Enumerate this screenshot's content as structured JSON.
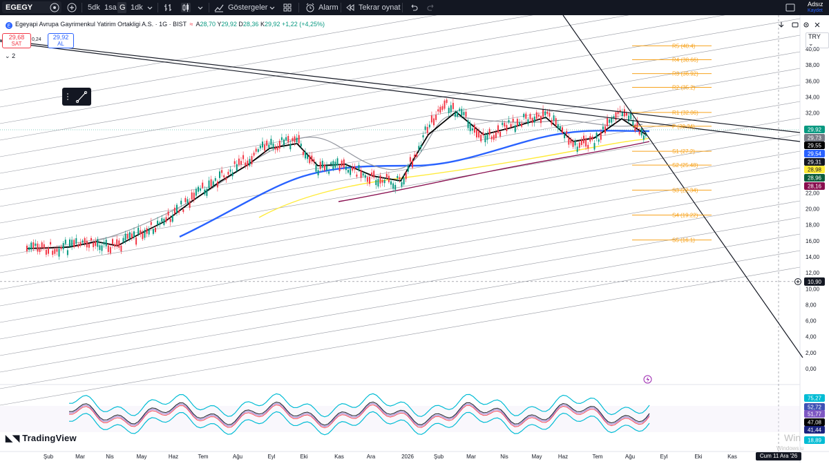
{
  "topbar": {
    "symbol": "EGEGY",
    "intervals": [
      "5dk",
      "1sa",
      "G",
      "1dk"
    ],
    "indicators_label": "Göstergeler",
    "alarm_label": "Alarm",
    "replay_label": "Tekrar oynat",
    "user_name": "Adsız",
    "save_label": "Kaydet"
  },
  "info": {
    "name": "Egeyapi Avrupa Gayrimenkul Yatirim Ortakligi A.S.",
    "meta": "· 1G · BIST",
    "o_label": "A",
    "o_value": "28,70",
    "h_label": "Y",
    "h_value": "29,92",
    "l_label": "D",
    "l_value": "28,36",
    "c_label": "K",
    "c_value": "29,92",
    "change": "+1,22 (+4,25%)"
  },
  "trade": {
    "sell_price": "29,68",
    "sell_label": "SAT",
    "spread": "0,24",
    "buy_price": "29,92",
    "buy_label": "AL"
  },
  "indicator_count": "2",
  "currency": "TRY",
  "price_axis": [
    "40,00",
    "38,00",
    "36,00",
    "34,00",
    "32,00",
    "30,00",
    "28,00",
    "26,00",
    "24,00",
    "22,00",
    "20,00",
    "18,00",
    "16,00",
    "14,00",
    "12,00",
    "10,00",
    "8,00",
    "6,00",
    "4,00",
    "2,00",
    "0,00"
  ],
  "price_tags": [
    {
      "label": "29,92",
      "color": "#089981"
    },
    {
      "label": "29,73",
      "color": "#787b86"
    },
    {
      "label": "29,55",
      "color": "#000000"
    },
    {
      "label": "29,54",
      "color": "#2962ff"
    },
    {
      "label": "29,31",
      "color": "#131722"
    },
    {
      "label": "28,98",
      "color": "#ffeb3b"
    },
    {
      "label": "28,96",
      "color": "#0b5d3b"
    },
    {
      "label": "28,16",
      "color": "#880e4f"
    }
  ],
  "cursor_price": "10,90",
  "pivots": [
    {
      "label": "R5 (40.4)",
      "price": 40.4
    },
    {
      "label": "R4 (38.66)",
      "price": 38.66
    },
    {
      "label": "R3 (36.92)",
      "price": 36.92
    },
    {
      "label": "R2 (35.2)",
      "price": 35.2
    },
    {
      "label": "R1 (32.06)",
      "price": 32.06
    },
    {
      "label": "P (30.34)",
      "price": 30.34
    },
    {
      "label": "S1 (27.2)",
      "price": 27.2
    },
    {
      "label": "S2 (25.48)",
      "price": 25.48
    },
    {
      "label": "S3 (22.34)",
      "price": 22.34
    },
    {
      "label": "S4 (19.22)",
      "price": 19.22
    },
    {
      "label": "S5 (16.1)",
      "price": 16.1
    }
  ],
  "rsi_tags": [
    {
      "label": "75,27",
      "color": "#00bcd4"
    },
    {
      "label": "52,72",
      "color": "#3f51b5"
    },
    {
      "label": "51,77",
      "color": "#7e57c2"
    },
    {
      "label": "47,08",
      "color": "#000000"
    },
    {
      "label": "41,44",
      "color": "#1a237e"
    },
    {
      "label": "18,89",
      "color": "#00bcd4"
    }
  ],
  "time_axis": [
    "Şub",
    "Mar",
    "Nis",
    "May",
    "Haz",
    "Tem",
    "Ağu",
    "Eyl",
    "Eki",
    "Kas",
    "Ara",
    "2026",
    "Şub",
    "Mar",
    "Nis",
    "May",
    "Haz",
    "Tem",
    "Ağu",
    "Eyl",
    "Eki",
    "Kas"
  ],
  "cursor_date": "Cum 11 Ara '26",
  "brand": "TradingView",
  "watermark": "Win",
  "watermark_sub": "Windows u"
}
